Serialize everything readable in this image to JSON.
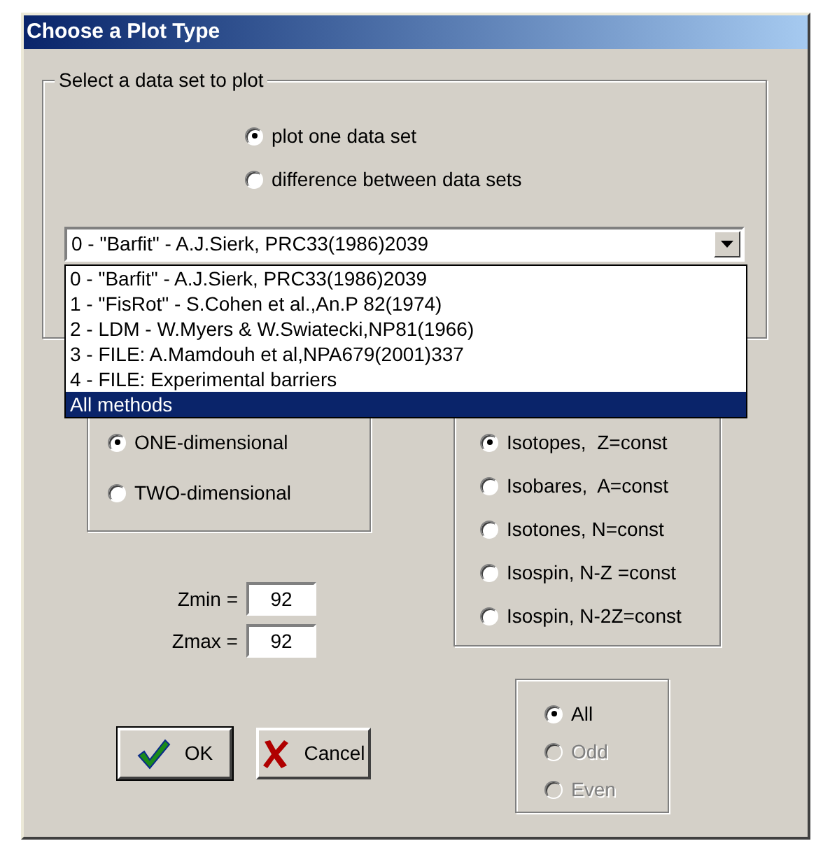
{
  "window": {
    "title": "Choose a Plot Type"
  },
  "dataset_group": {
    "legend": "Select a data set to plot",
    "mode_options": [
      {
        "label": "plot one data set",
        "selected": true
      },
      {
        "label": "difference between data sets",
        "selected": false
      }
    ],
    "combo": {
      "value": "0 - \"Barfit\" - A.J.Sierk, PRC33(1986)2039"
    },
    "dropdown": {
      "items": [
        {
          "label": "0 - \"Barfit\" - A.J.Sierk, PRC33(1986)2039",
          "selected": false
        },
        {
          "label": "1 - \"FisRot\" - S.Cohen et al.,An.P 82(1974)",
          "selected": false
        },
        {
          "label": "2 - LDM - W.Myers & W.Swiatecki,NP81(1966)",
          "selected": false
        },
        {
          "label": "3 - FILE: A.Mamdouh et al,NPA679(2001)337",
          "selected": false
        },
        {
          "label": "4 - FILE: Experimental barriers",
          "selected": false
        },
        {
          "label": "All methods",
          "selected": true
        }
      ]
    }
  },
  "dimension_options": [
    {
      "label": "ONE-dimensional",
      "selected": true
    },
    {
      "label": "TWO-dimensional",
      "selected": false
    }
  ],
  "series_options": [
    {
      "label": "Isotopes,  Z=const",
      "selected": true
    },
    {
      "label": "Isobares,  A=const",
      "selected": false
    },
    {
      "label": "Isotones, N=const",
      "selected": false
    },
    {
      "label": "Isospin, N-Z =const",
      "selected": false
    },
    {
      "label": "Isospin, N-2Z=const",
      "selected": false
    }
  ],
  "zmin": {
    "label": "Zmin =",
    "value": "92"
  },
  "zmax": {
    "label": "Zmax =",
    "value": "92"
  },
  "buttons": [
    {
      "label": "OK",
      "kind": "ok"
    },
    {
      "label": "Cancel",
      "kind": "cancel"
    }
  ],
  "parity_options": [
    {
      "label": "All",
      "selected": true,
      "disabled": false
    },
    {
      "label": "Odd",
      "selected": false,
      "disabled": true
    },
    {
      "label": "Even",
      "selected": false,
      "disabled": true
    }
  ]
}
